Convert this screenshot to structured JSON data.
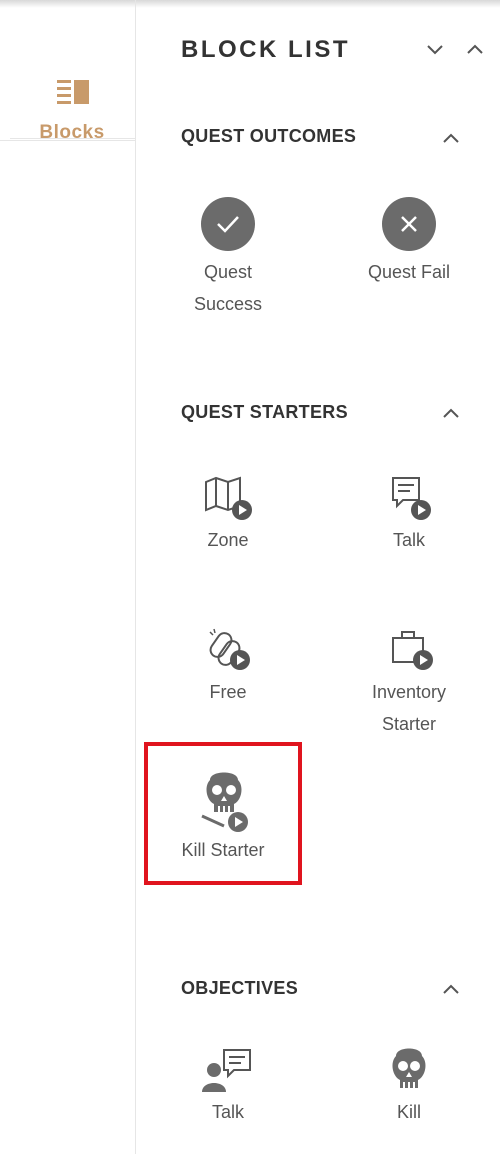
{
  "rail": {
    "tab_label": "Blocks",
    "tab_icon": "blocks-list-icon",
    "accent_color": "#c89a6a"
  },
  "panel": {
    "title": "BLOCK LIST",
    "collapse_all_icon": "chevron-down-icon",
    "expand_all_icon": "chevron-up-icon"
  },
  "sections": {
    "outcomes": {
      "title": "QUEST OUTCOMES",
      "items": [
        {
          "label_line1": "Quest",
          "label_line2": "Success",
          "icon": "check-circle-icon"
        },
        {
          "label_line1": "Quest Fail",
          "label_line2": "",
          "icon": "x-circle-icon"
        }
      ]
    },
    "starters": {
      "title": "QUEST STARTERS",
      "items": [
        {
          "label_line1": "Zone",
          "label_line2": "",
          "icon": "map-play-icon"
        },
        {
          "label_line1": "Talk",
          "label_line2": "",
          "icon": "speech-play-icon"
        },
        {
          "label_line1": "Free",
          "label_line2": "",
          "icon": "link-play-icon"
        },
        {
          "label_line1": "Inventory",
          "label_line2": "Starter",
          "icon": "briefcase-play-icon"
        },
        {
          "label_line1": "Kill Starter",
          "label_line2": "",
          "icon": "skull-play-icon"
        }
      ]
    },
    "objectives": {
      "title": "OBJECTIVES",
      "items": [
        {
          "label_line1": "Talk",
          "label_line2": "",
          "icon": "person-speech-icon"
        },
        {
          "label_line1": "Kill",
          "label_line2": "",
          "icon": "skull-icon"
        }
      ]
    }
  },
  "colors": {
    "icon_gray": "#6b6b6b",
    "highlight": "#e0141e",
    "title_text": "#333333"
  }
}
